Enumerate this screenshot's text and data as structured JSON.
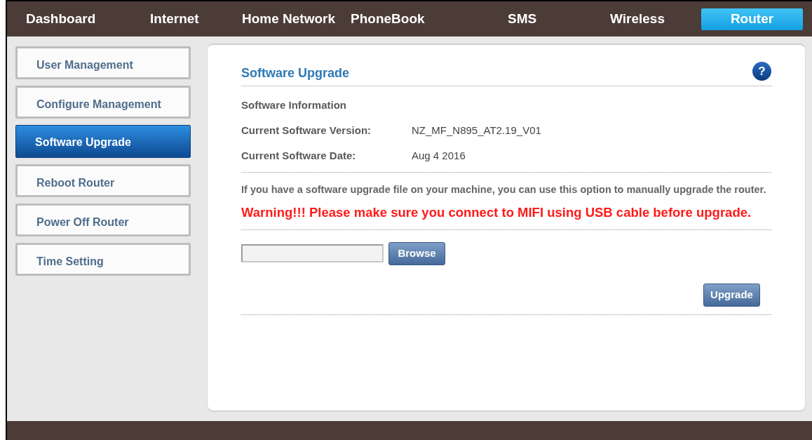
{
  "nav": [
    {
      "label": "Dashboard",
      "selected": false
    },
    {
      "label": "Internet",
      "selected": false
    },
    {
      "label": "Home Network",
      "selected": false
    },
    {
      "label": "PhoneBook",
      "selected": false
    },
    {
      "label": "SMS",
      "selected": false
    },
    {
      "label": "Wireless",
      "selected": false
    },
    {
      "label": "Router",
      "selected": true
    }
  ],
  "sidebar": {
    "items": [
      {
        "label": "User Management",
        "selected": false
      },
      {
        "label": "Configure Management",
        "selected": false
      },
      {
        "label": "Software Upgrade",
        "selected": true
      },
      {
        "label": "Reboot Router",
        "selected": false
      },
      {
        "label": "Power Off Router",
        "selected": false
      },
      {
        "label": "Time Setting",
        "selected": false
      }
    ]
  },
  "panel": {
    "title": "Software Upgrade",
    "help": "?",
    "section_title": "Software Information",
    "info": [
      {
        "label": "Current Software Version:",
        "value": "NZ_MF_N895_AT2.19_V01"
      },
      {
        "label": "Current Software Date:",
        "value": "Aug 4 2016"
      }
    ],
    "description": "If you have a software upgrade file on your machine, you can use this option to manually upgrade the router.",
    "warning": "Warning!!! Please make sure you connect to MIFI using USB cable before upgrade.",
    "browse_button": "Browse",
    "upgrade_button": "Upgrade"
  }
}
